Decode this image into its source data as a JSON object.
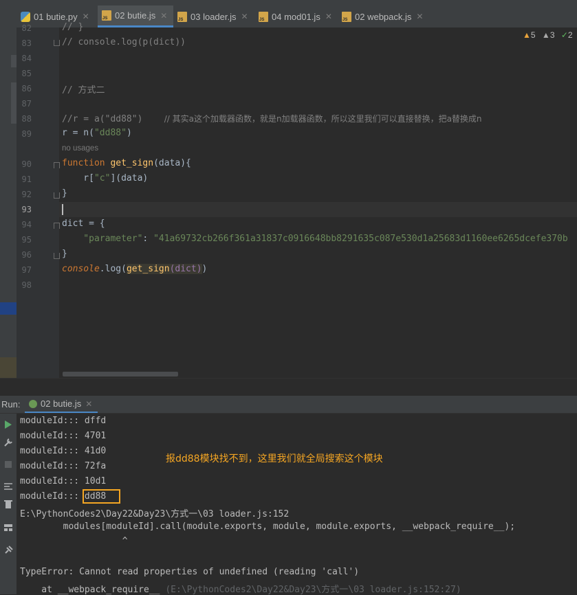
{
  "tabs": [
    {
      "label": "01 butie.py",
      "icon": "python-file-icon",
      "active": false
    },
    {
      "label": "02 butie.js",
      "icon": "js-file-icon",
      "active": true
    },
    {
      "label": "03 loader.js",
      "icon": "js-file-icon",
      "active": false
    },
    {
      "label": "04 mod01.js",
      "icon": "js-file-icon",
      "active": false
    },
    {
      "label": "02 webpack.js",
      "icon": "js-file-icon",
      "active": false
    }
  ],
  "inspections": {
    "warnings": "5",
    "weak_warnings": "3",
    "ok": "2"
  },
  "editor": {
    "line_numbers": [
      "82",
      "83",
      "84",
      "85",
      "86",
      "87",
      "88",
      "89",
      "90",
      "91",
      "92",
      "93",
      "94",
      "95",
      "96",
      "97",
      "98"
    ],
    "line82": "// }",
    "line83": "// console.log(p(dict))",
    "line86": "// 方式二",
    "line88_code": "//r = a(\"dd88\")",
    "line88_comment": "// 其实a这个加载器函数，就是n加载器函数，所以这里我们可以直接替换，把a替换成n",
    "line89_a": "r = n(",
    "line89_str": "\"dd88\"",
    "line89_b": ")",
    "usage_hint": "no usages",
    "line90_kw": "function",
    "line90_fn": "get_sign",
    "line90_rest": "(data){",
    "line91_a": "    r[",
    "line91_str": "\"c\"",
    "line91_b": "](data)",
    "line92": "}",
    "line94": "dict = {",
    "line95_key": "    \"parameter\"",
    "line95_colon": ": ",
    "line95_val": "\"41a69732cb266f361a31837c0916648bb8291635c087e530d1a25683d1160ee6265dcefe370b",
    "line96": "}",
    "line97_obj": "console",
    "line97_dot": ".log(",
    "line97_fn": "get_sign",
    "line97_arg": "(dict)",
    "line97_end": ")"
  },
  "run": {
    "label": "Run:",
    "tab_label": "02 butie.js",
    "output": [
      "moduleId::: dffd",
      "moduleId::: 4701",
      "moduleId::: 41d0",
      "moduleId::: 72fa",
      "moduleId::: 10d1"
    ],
    "last_module_prefix": "moduleId::: ",
    "last_module_id": "dd88",
    "error_path": "E:\\PythonCodes2\\Day22&Day23\\方式一\\03 loader.js:152",
    "error_code": "        modules[moduleId].call(module.exports, module, module.exports, __webpack_require__);",
    "error_caret": "                   ^",
    "error_type": "TypeError: Cannot read properties of undefined (reading 'call')",
    "stack_at": "    at __webpack_require__ ",
    "stack_loc": "(E:\\PythonCodes2\\Day22&Day23\\方式一\\03 loader.js:152:27)"
  },
  "annotation": "报dd88模块找不到，这里我们就全局搜索这个模块",
  "colors": {
    "annotation": "#f5a623",
    "highlight_box": "#f5a623",
    "active_tab_underline": "#4a88c7"
  }
}
